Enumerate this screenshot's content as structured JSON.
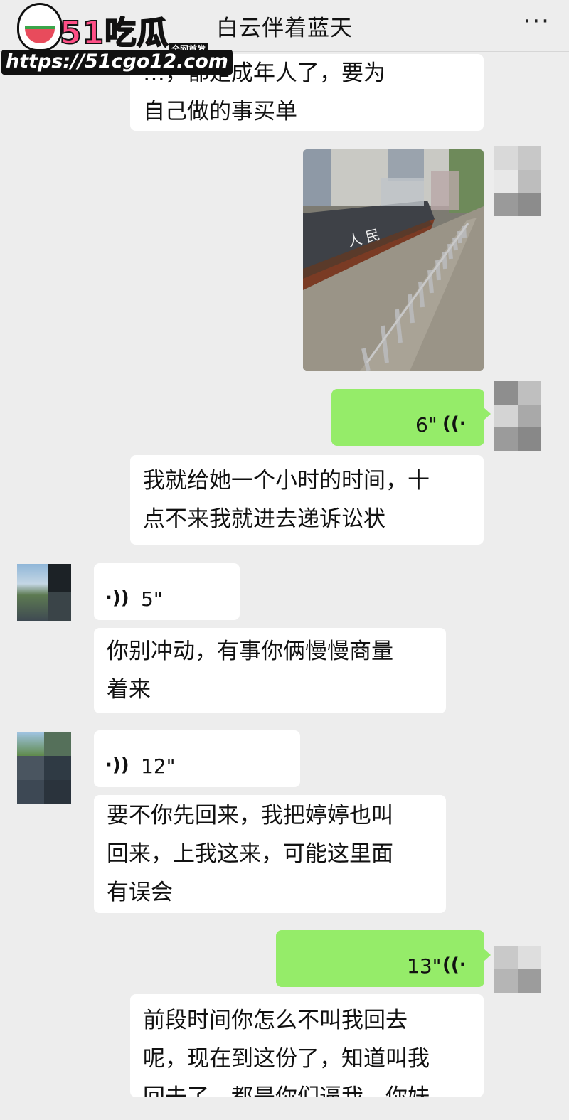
{
  "header": {
    "title": "白云伴着蓝天",
    "more_label": "···"
  },
  "watermark": {
    "logo_text": "51吃瓜",
    "badge": "全网首发",
    "url": "https://51cgo12.com"
  },
  "messages": {
    "m1": [
      "…，都是成年人了，要为",
      "自己做的事买单"
    ],
    "m2": [
      "我就给她一个小时的时间，十",
      "点不来我就进去递诉讼状"
    ],
    "m3": [
      "你别冲动，有事你俩慢慢商量",
      "着来"
    ],
    "m4": [
      "要不你先回来，我把婷婷也叫",
      "回来，上我这来，可能这里面",
      "有误会"
    ],
    "m5": [
      "前段时间你怎么不叫我回去",
      "呢，现在到这份了，知道叫我",
      "回去了，都是你们逼我，你妹"
    ]
  },
  "voice": {
    "v1": "6\"",
    "v2": "5\"",
    "v3": "12\"",
    "v4": "13\""
  },
  "icons": {
    "wave_right": "((·",
    "wave_left": "·))"
  },
  "photo": {
    "sign_text": "人民"
  },
  "colors": {
    "background": "#ededed",
    "self_bubble": "#95ec69",
    "other_bubble": "#ffffff"
  }
}
